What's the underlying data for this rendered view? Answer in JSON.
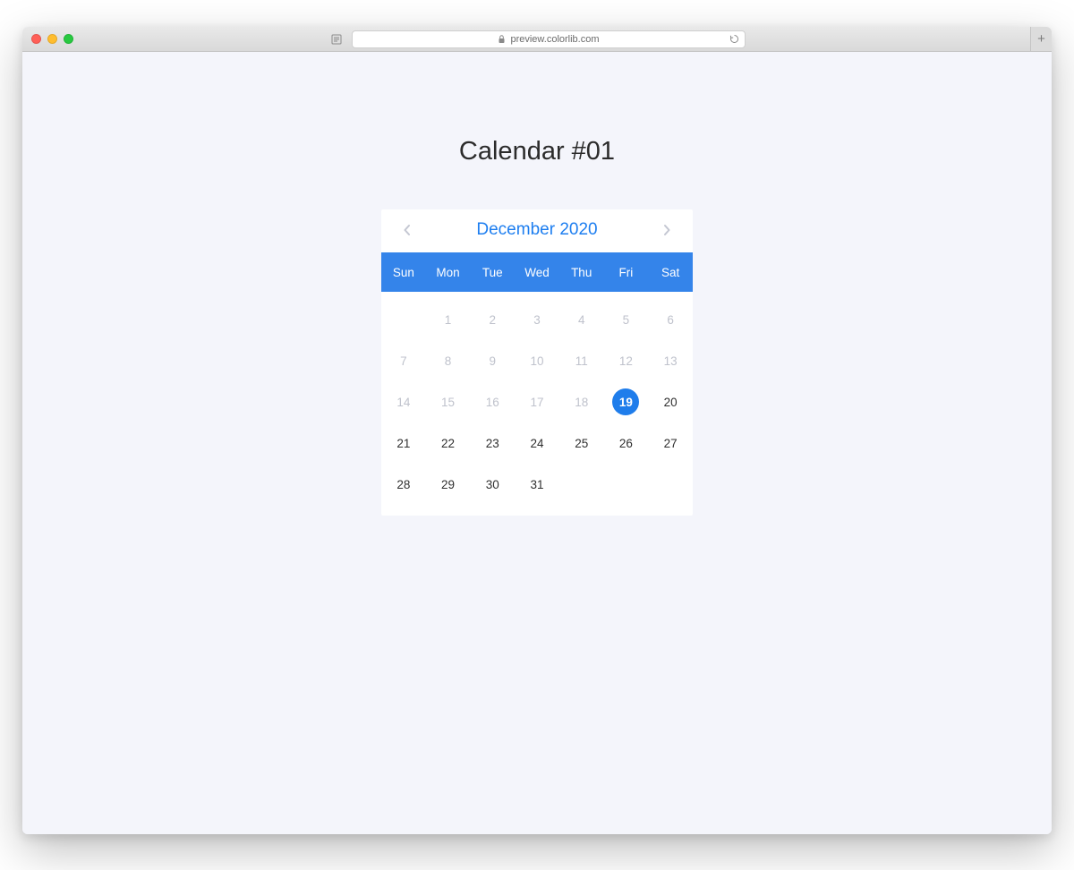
{
  "browser": {
    "url_host": "preview.colorlib.com"
  },
  "page": {
    "title": "Calendar #01"
  },
  "calendar": {
    "month_label": "December 2020",
    "weekdays": [
      "Sun",
      "Mon",
      "Tue",
      "Wed",
      "Thu",
      "Fri",
      "Sat"
    ],
    "days": [
      {
        "n": "",
        "state": "blank"
      },
      {
        "n": "1",
        "state": "muted"
      },
      {
        "n": "2",
        "state": "muted"
      },
      {
        "n": "3",
        "state": "muted"
      },
      {
        "n": "4",
        "state": "muted"
      },
      {
        "n": "5",
        "state": "muted"
      },
      {
        "n": "6",
        "state": "muted"
      },
      {
        "n": "7",
        "state": "muted"
      },
      {
        "n": "8",
        "state": "muted"
      },
      {
        "n": "9",
        "state": "muted"
      },
      {
        "n": "10",
        "state": "muted"
      },
      {
        "n": "11",
        "state": "muted"
      },
      {
        "n": "12",
        "state": "muted"
      },
      {
        "n": "13",
        "state": "muted"
      },
      {
        "n": "14",
        "state": "muted"
      },
      {
        "n": "15",
        "state": "muted"
      },
      {
        "n": "16",
        "state": "muted"
      },
      {
        "n": "17",
        "state": "muted"
      },
      {
        "n": "18",
        "state": "muted"
      },
      {
        "n": "19",
        "state": "selected"
      },
      {
        "n": "20",
        "state": ""
      },
      {
        "n": "21",
        "state": ""
      },
      {
        "n": "22",
        "state": ""
      },
      {
        "n": "23",
        "state": ""
      },
      {
        "n": "24",
        "state": ""
      },
      {
        "n": "25",
        "state": ""
      },
      {
        "n": "26",
        "state": ""
      },
      {
        "n": "27",
        "state": ""
      },
      {
        "n": "28",
        "state": ""
      },
      {
        "n": "29",
        "state": ""
      },
      {
        "n": "30",
        "state": ""
      },
      {
        "n": "31",
        "state": ""
      }
    ]
  }
}
